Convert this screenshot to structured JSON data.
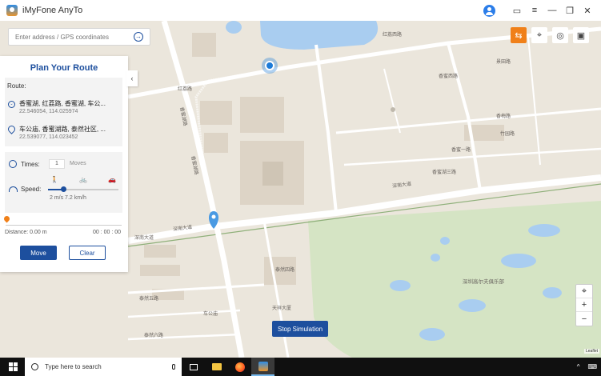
{
  "app": {
    "title": "iMyFone AnyTo"
  },
  "titlebar": {
    "icons": [
      "user-avatar-icon",
      "feedback-icon",
      "menu-icon",
      "minimize-icon",
      "restore-icon",
      "close-icon"
    ],
    "glyphs": {
      "feedback": "▭",
      "menu": "≡",
      "minimize": "—",
      "restore": "❐",
      "close": "✕"
    }
  },
  "search": {
    "placeholder": "Enter address / GPS coordinates",
    "go_glyph": "→"
  },
  "panel": {
    "title": "Plan Your Route",
    "route_label": "Route:",
    "collapse_glyph": "‹",
    "stops": [
      {
        "name": "香蜜湖, 红荔路, 香蜜湖, 车公...",
        "coords": "22.546054, 114.025974",
        "icon": "start-point-icon"
      },
      {
        "name": "车公庙, 香蜜湖路, 泰然社区, ...",
        "coords": "22.539077, 114.023452",
        "icon": "end-point-icon"
      }
    ],
    "times_label": "Times:",
    "times_value": "1",
    "moves_label": "Moves",
    "speed_label": "Speed:",
    "speed_value": "2 m/s 7.2 km/h",
    "speed_fraction": 0.22,
    "modes": {
      "walk": "🚶",
      "bike": "🚲",
      "car": "🚗"
    },
    "progress_fraction": 0.0,
    "distance": "Distance: 0.00 m",
    "elapsed": "00 : 00 : 00",
    "move_label": "Move",
    "clear_label": "Clear"
  },
  "toolbar": {
    "tools": [
      {
        "name": "multi-spot-route-icon",
        "glyph": "⇆",
        "active": true
      },
      {
        "name": "jump-teleport-icon",
        "glyph": "⌖",
        "active": false
      },
      {
        "name": "teleport-mode-icon",
        "glyph": "◎",
        "active": false
      },
      {
        "name": "history-icon",
        "glyph": "▣",
        "active": false
      }
    ]
  },
  "zoom": {
    "locate_glyph": "⌖",
    "in_glyph": "+",
    "out_glyph": "−"
  },
  "map_labels": [
    "红荔西路",
    "红荔路",
    "香蜜西路",
    "香蜜湖路",
    "香蜜一路",
    "香梅路",
    "香蜜湖路",
    "香蜜湖三路",
    "深南大道",
    "深南大道",
    "深南大道",
    "泰然四路",
    "泰然五路",
    "泰然六路",
    "车公庙",
    "天祥大厦",
    "深圳高尔夫俱乐部",
    "景田路",
    "竹园路"
  ],
  "stop_simulation_label": "Stop Simulation",
  "attribution": "Leaflet",
  "taskbar": {
    "search_text": "Type here to search",
    "tray": {
      "chevron": "^",
      "keyboard": "⌨"
    }
  },
  "colors": {
    "accent_blue": "#1d4f9e",
    "accent_orange": "#f08019",
    "map_bg": "#ebe6dc",
    "golf_green": "#d5e4c4",
    "water": "#a9cdf0"
  }
}
